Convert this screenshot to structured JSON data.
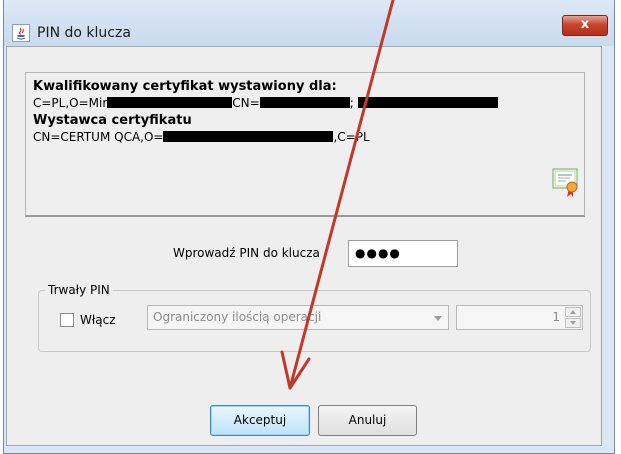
{
  "window": {
    "title": "PIN do klucza",
    "close_label": "x",
    "app_icon": "java-icon"
  },
  "certificate": {
    "heading_owner": "Kwalifikowany certyfikat wystawiony dla:",
    "owner_prefix": "C=PL,O=Mir",
    "owner_mid": "CN=",
    "owner_sep": ";",
    "heading_issuer": "Wystawca certyfikatu",
    "issuer_prefix": "CN=CERTUM QCA,O=",
    "issuer_suffix": ",C=PL",
    "icon": "certificate-icon"
  },
  "pin": {
    "label": "Wprowadź PIN do klucza",
    "value": "●●●●"
  },
  "persistent_pin": {
    "group_label": "Trwały PIN",
    "checkbox_label": "Włącz",
    "checked": false,
    "select_value": "Ograniczony ilością operacji",
    "spinner_value": "1"
  },
  "buttons": {
    "accept": "Akceptuj",
    "cancel": "Anuluj"
  },
  "colors": {
    "annotation_arrow": "#c0392b",
    "close_button": "#c7452e",
    "default_button_border": "#3b8ad0"
  }
}
